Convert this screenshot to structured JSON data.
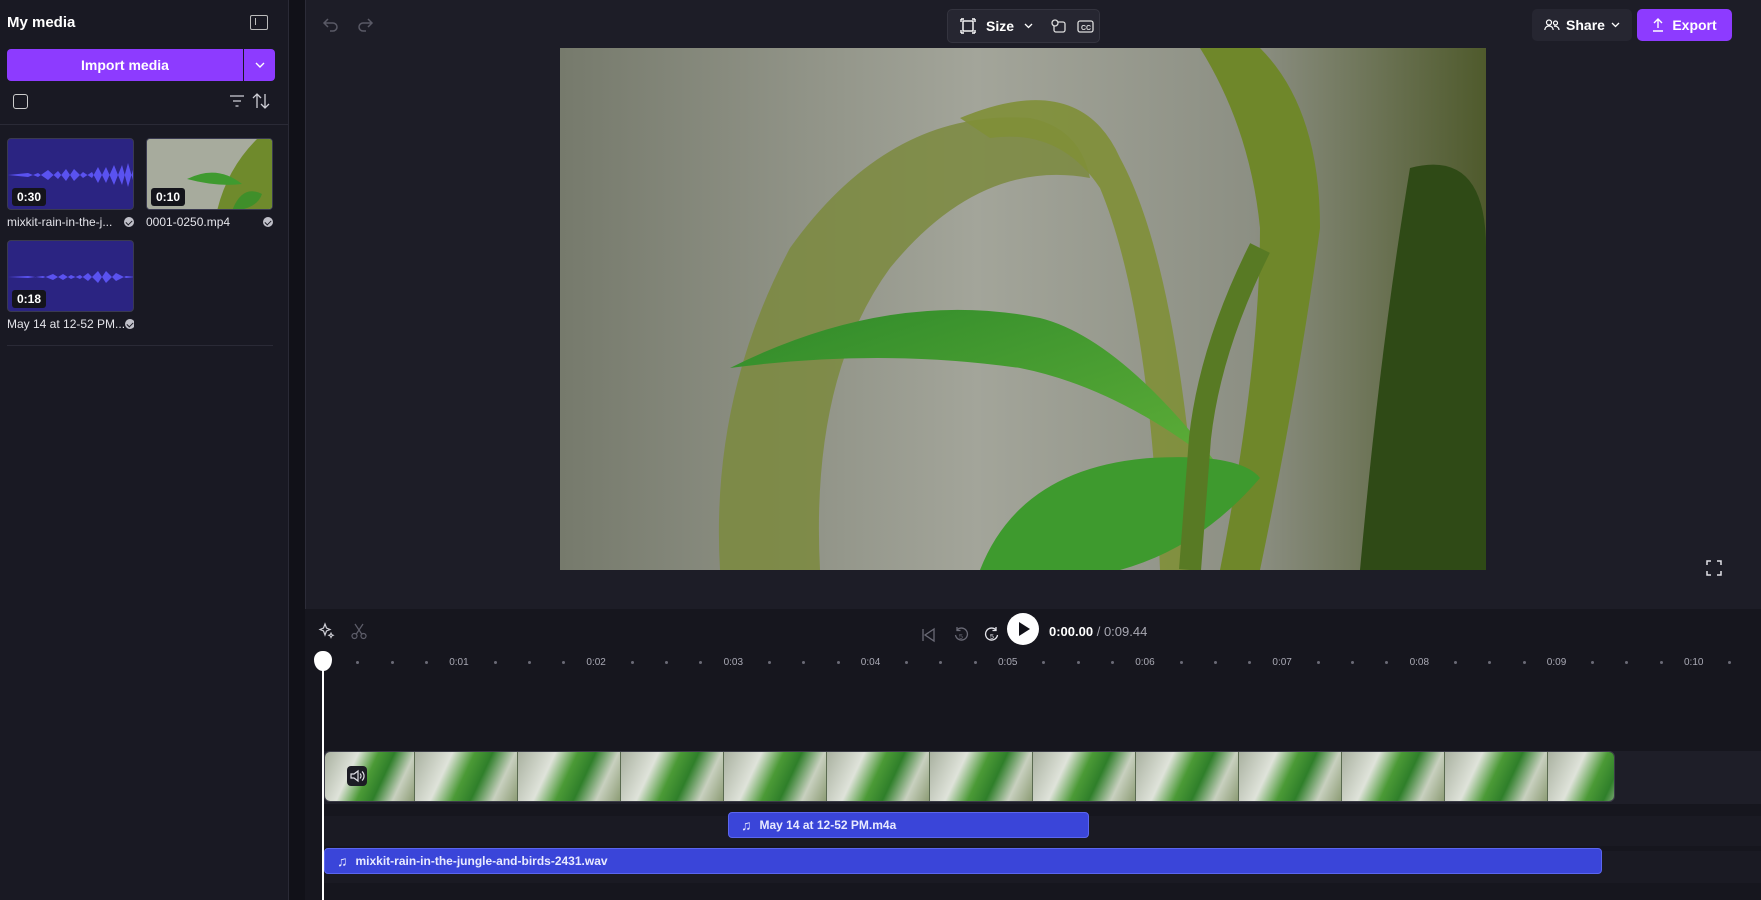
{
  "left_panel": {
    "title": "My media",
    "import_label": "Import media",
    "media": [
      {
        "name": "mixkit-rain-in-the-j...",
        "duration": "0:30",
        "type": "audio"
      },
      {
        "name": "0001-0250.mp4",
        "duration": "0:10",
        "type": "video"
      },
      {
        "name": "May 14 at 12-52 PM...",
        "duration": "0:18",
        "type": "audio"
      }
    ]
  },
  "toolbar": {
    "size_label": "Size",
    "share_label": "Share",
    "export_label": "Export"
  },
  "playback": {
    "current_time": "0:00.00",
    "total_time": "/ 0:09.44"
  },
  "ruler": {
    "labels": [
      "0:01",
      "0:02",
      "0:03",
      "0:04",
      "0:05",
      "0:06",
      "0:07",
      "0:08",
      "0:09",
      "0:10"
    ]
  },
  "timeline": {
    "audio_clip_1": "May 14 at 12-52 PM.m4a",
    "audio_clip_2": "mixkit-rain-in-the-jungle-and-birds-2431.wav"
  },
  "colors": {
    "accent": "#8d3bff",
    "audio_clip": "#3a45d9"
  },
  "icons": {
    "collapse_panel": "panel-collapse-icon",
    "undo": "undo-icon",
    "redo": "redo-icon",
    "size": "resize-icon",
    "share": "people-icon",
    "export": "upload-icon",
    "fullscreen": "fullscreen-icon",
    "ai": "sparkle-icon",
    "split": "scissors-icon",
    "skip_start": "skip-start-icon",
    "rewind5": "rewind-5-icon",
    "forward5": "forward-5-icon",
    "play": "play-icon",
    "volume": "volume-icon",
    "music": "music-note-icon"
  }
}
